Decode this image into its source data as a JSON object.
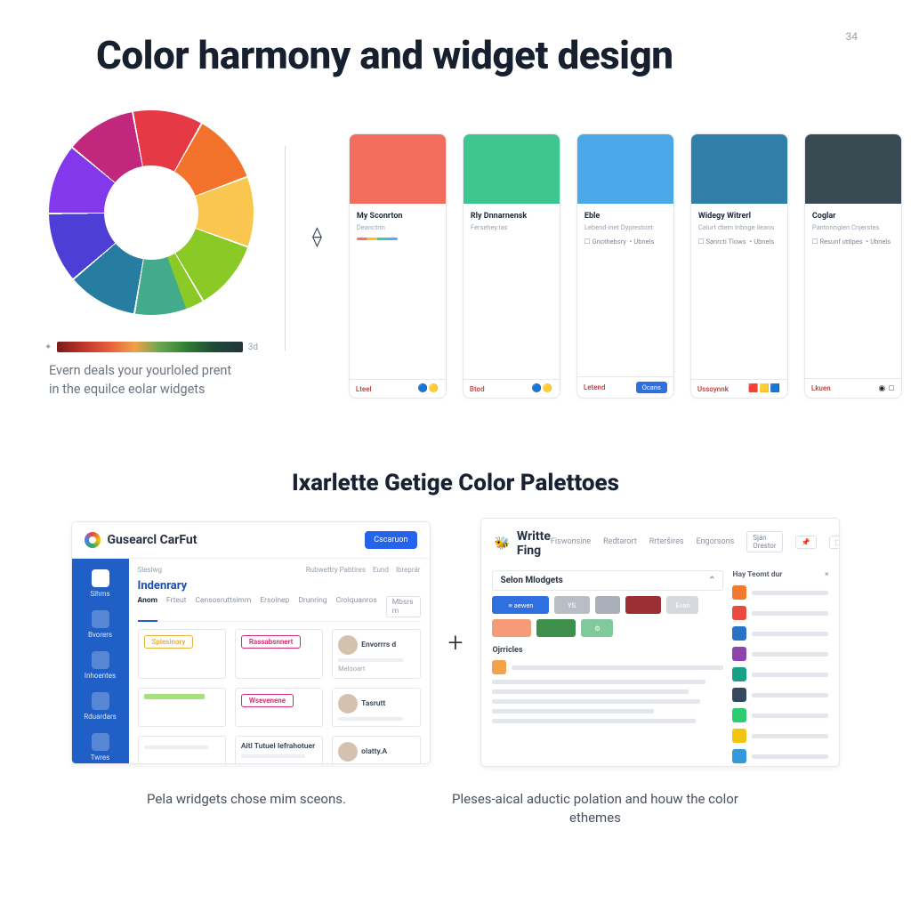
{
  "title": "Color harmony and widget design",
  "title_sup": "34",
  "wheel": {
    "segments": [
      "#e63946",
      "#f3722c",
      "#f9c74f",
      "#8ac926",
      "#43aa8b",
      "#277da1",
      "#4d3fd6",
      "#8338ec",
      "#c1287d"
    ],
    "bar_end_label": "3d",
    "caption_l1": "Evern deals your yourloled prent",
    "caption_l2": "in the equilce eolar widgets"
  },
  "arrow_glyph": "⟠",
  "cards": [
    {
      "color": "#f26d5b",
      "title": "My Sconrton",
      "sub": "Deanctrin",
      "foot_left": "Lteel"
    },
    {
      "color": "#3fc68e",
      "title": "Rly Dnnarnensk",
      "sub": "Fersehey:las",
      "foot_left": "Btod"
    },
    {
      "color": "#4aa7e8",
      "title": "Eble",
      "sub": "Lebend-inet Dyprestont",
      "line2": "Gnothebsry",
      "foot_left": "Letend",
      "foot_btn": "Ocans"
    },
    {
      "color": "#2f7fa8",
      "title": "Widegy Witrerl",
      "sub": "Calurt dtern lnbnge ileans",
      "line2": "Sanrcti Tlows",
      "foot_left": "Ussoynnk"
    },
    {
      "color": "#384b53",
      "title": "Coglar",
      "sub": "Pantoringlen Cnjerstes",
      "line2": "Resunf uttlpes",
      "foot_left": "Lkuen"
    }
  ],
  "section2_title": "Ixarlette Getige Color Palettoes",
  "app1": {
    "brand": "Gusearcl CarFut",
    "cta": "Cscaruon",
    "side": [
      "Slhms",
      "Bvorers",
      "Inhoentes",
      "Rduardars",
      "Twres"
    ],
    "pre": "Sleslwg",
    "heading": "Indenrary",
    "top_right": [
      "Rubwettry Pabtires",
      "Eund",
      "Ibreprár"
    ],
    "tabs": [
      "Anom",
      "Frteut",
      "Censosruttsimm",
      "Ersolnep",
      "Drunring",
      "Crolquanros"
    ],
    "tab_right": "Mbsrs m",
    "cells": [
      {
        "pill": "Splesinory",
        "pill_color": "#e4b23a"
      },
      {
        "pill": "Rassabsnnert",
        "pill_color": "#d62870"
      },
      {
        "name": "Envorrrs d",
        "sub": "Melooart"
      },
      {
        "bar_color": "#a6e07a",
        "text": ""
      },
      {
        "pill": "Wsevenene",
        "pill_color": "#d62870"
      },
      {
        "name": "Tasrutt",
        "text": ""
      },
      {
        "text": ""
      },
      {
        "name": "Aitl Tutuel Iefrahotuer",
        "text": ""
      },
      {
        "name": "olatty.A",
        "text": ""
      }
    ]
  },
  "app2": {
    "brand": "Writte Fing",
    "nav": [
      "Fiswonsine",
      "Redtarort",
      "Rrteršires",
      "Engorsons"
    ],
    "nav_pill": "Sjan Orestor",
    "section": "Selon Mlodgets",
    "chips": [
      {
        "c": "#2f6fe0",
        "w": 64,
        "label": "≡ aewen"
      },
      {
        "c": "#b9bec6",
        "w": 40,
        "label": "YS."
      },
      {
        "c": "#aab0b9",
        "w": 28
      },
      {
        "c": "#9a2f34",
        "w": 40
      },
      {
        "c": "#d6dadf",
        "w": 36,
        "label": "Evan"
      },
      {
        "c": "#f59b7a",
        "w": 44
      },
      {
        "c": "#3f8f4c",
        "w": 44
      },
      {
        "c": "#7fc99a",
        "w": 36,
        "label": "⚙"
      }
    ],
    "subhead": "Ojrricles",
    "side_title": "Hay Teomt dur",
    "side_colors": [
      "#f07b2e",
      "#e74c3c",
      "#2a72c4",
      "#8e44ad",
      "#16a085",
      "#34495e",
      "#2ecc71",
      "#f1c40f",
      "#3498db"
    ]
  },
  "captions": {
    "left": "Pela wridgets chose mim sceons.",
    "right": "Pleses-aical aductic polation and houw the color ethemes"
  }
}
